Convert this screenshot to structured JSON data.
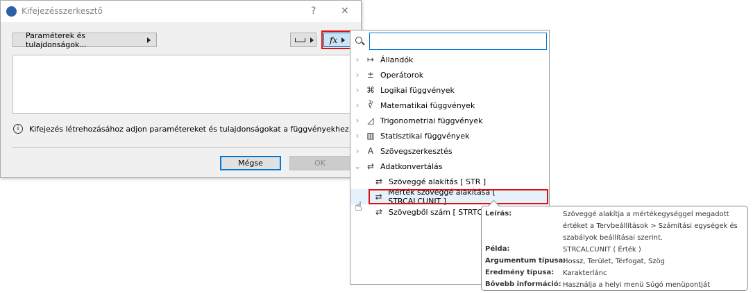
{
  "dialog": {
    "title": "Kifejezésszerkesztő",
    "help": "?",
    "close": "✕",
    "params_button": "Paraméterek és tulajdonságok...",
    "info_text": "Kifejezés létrehozásához adjon paramétereket és tulajdonságokat a függvényekhez.",
    "cancel": "Mégse",
    "ok": "OK",
    "fx_label": "fx"
  },
  "popup": {
    "search_value": "",
    "items": [
      {
        "label": "Állandók",
        "icon": "constants-icon",
        "glyph": "↦",
        "chev": "›"
      },
      {
        "label": "Operátorok",
        "icon": "operators-icon",
        "glyph": "±",
        "chev": "›"
      },
      {
        "label": "Logikai függvények",
        "icon": "puzzle-icon",
        "glyph": "⌘",
        "chev": "›"
      },
      {
        "label": "Matematikai függvények",
        "icon": "root-icon",
        "glyph": "∛",
        "chev": "›"
      },
      {
        "label": "Trigonometriai függvények",
        "icon": "triangle-icon",
        "glyph": "◿",
        "chev": "›"
      },
      {
        "label": "Statisztikai függvények",
        "icon": "histogram-icon",
        "glyph": "▥",
        "chev": "›"
      },
      {
        "label": "Szövegszerkesztés",
        "icon": "text-icon",
        "glyph": "A",
        "chev": "›"
      },
      {
        "label": "Adatkonvertálás",
        "icon": "convert-icon",
        "glyph": "⇄",
        "chev": "⌄"
      }
    ],
    "sub_items": [
      {
        "label": "Szöveggé alakítás [ STR ]"
      },
      {
        "label": "Mérték szöveggé alakítása [ STRCALCUNIT ]"
      },
      {
        "label": "Szövegből szám [ STRTONUM ]"
      }
    ]
  },
  "tooltip": {
    "rows": [
      {
        "k": "Leírás:",
        "v": "Szöveggé alakítja a mértékegységgel megadott értéket a Tervbeállítások > Számítási egységek és szabályok beállításai szerint."
      },
      {
        "k": "Példa:",
        "v": "STRCALCUNIT ( Érték )"
      },
      {
        "k": "Argumentum típusa:",
        "v": "Hossz, Terület, Térfogat, Szög"
      },
      {
        "k": "Eredmény típusa:",
        "v": "Karakterlánc"
      },
      {
        "k": "Bővebb információ:",
        "v": "Használja a helyi menü Súgó menüpontját"
      }
    ]
  }
}
